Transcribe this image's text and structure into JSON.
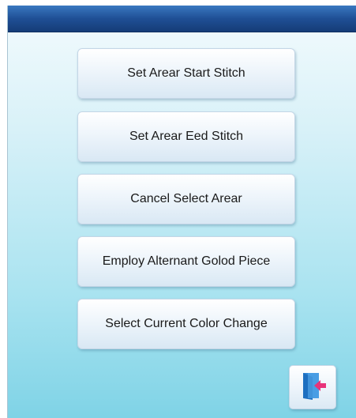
{
  "menu": {
    "items": [
      {
        "label": "Set Arear Start Stitch"
      },
      {
        "label": "Set Arear Eed Stitch"
      },
      {
        "label": "Cancel Select Arear"
      },
      {
        "label": "Employ Alternant Golod Piece"
      },
      {
        "label": "Select Current Color Change"
      }
    ]
  },
  "exit": {
    "icon": "exit-door-icon",
    "door_color": "#2f86d8",
    "arrow_color": "#e8337a"
  }
}
